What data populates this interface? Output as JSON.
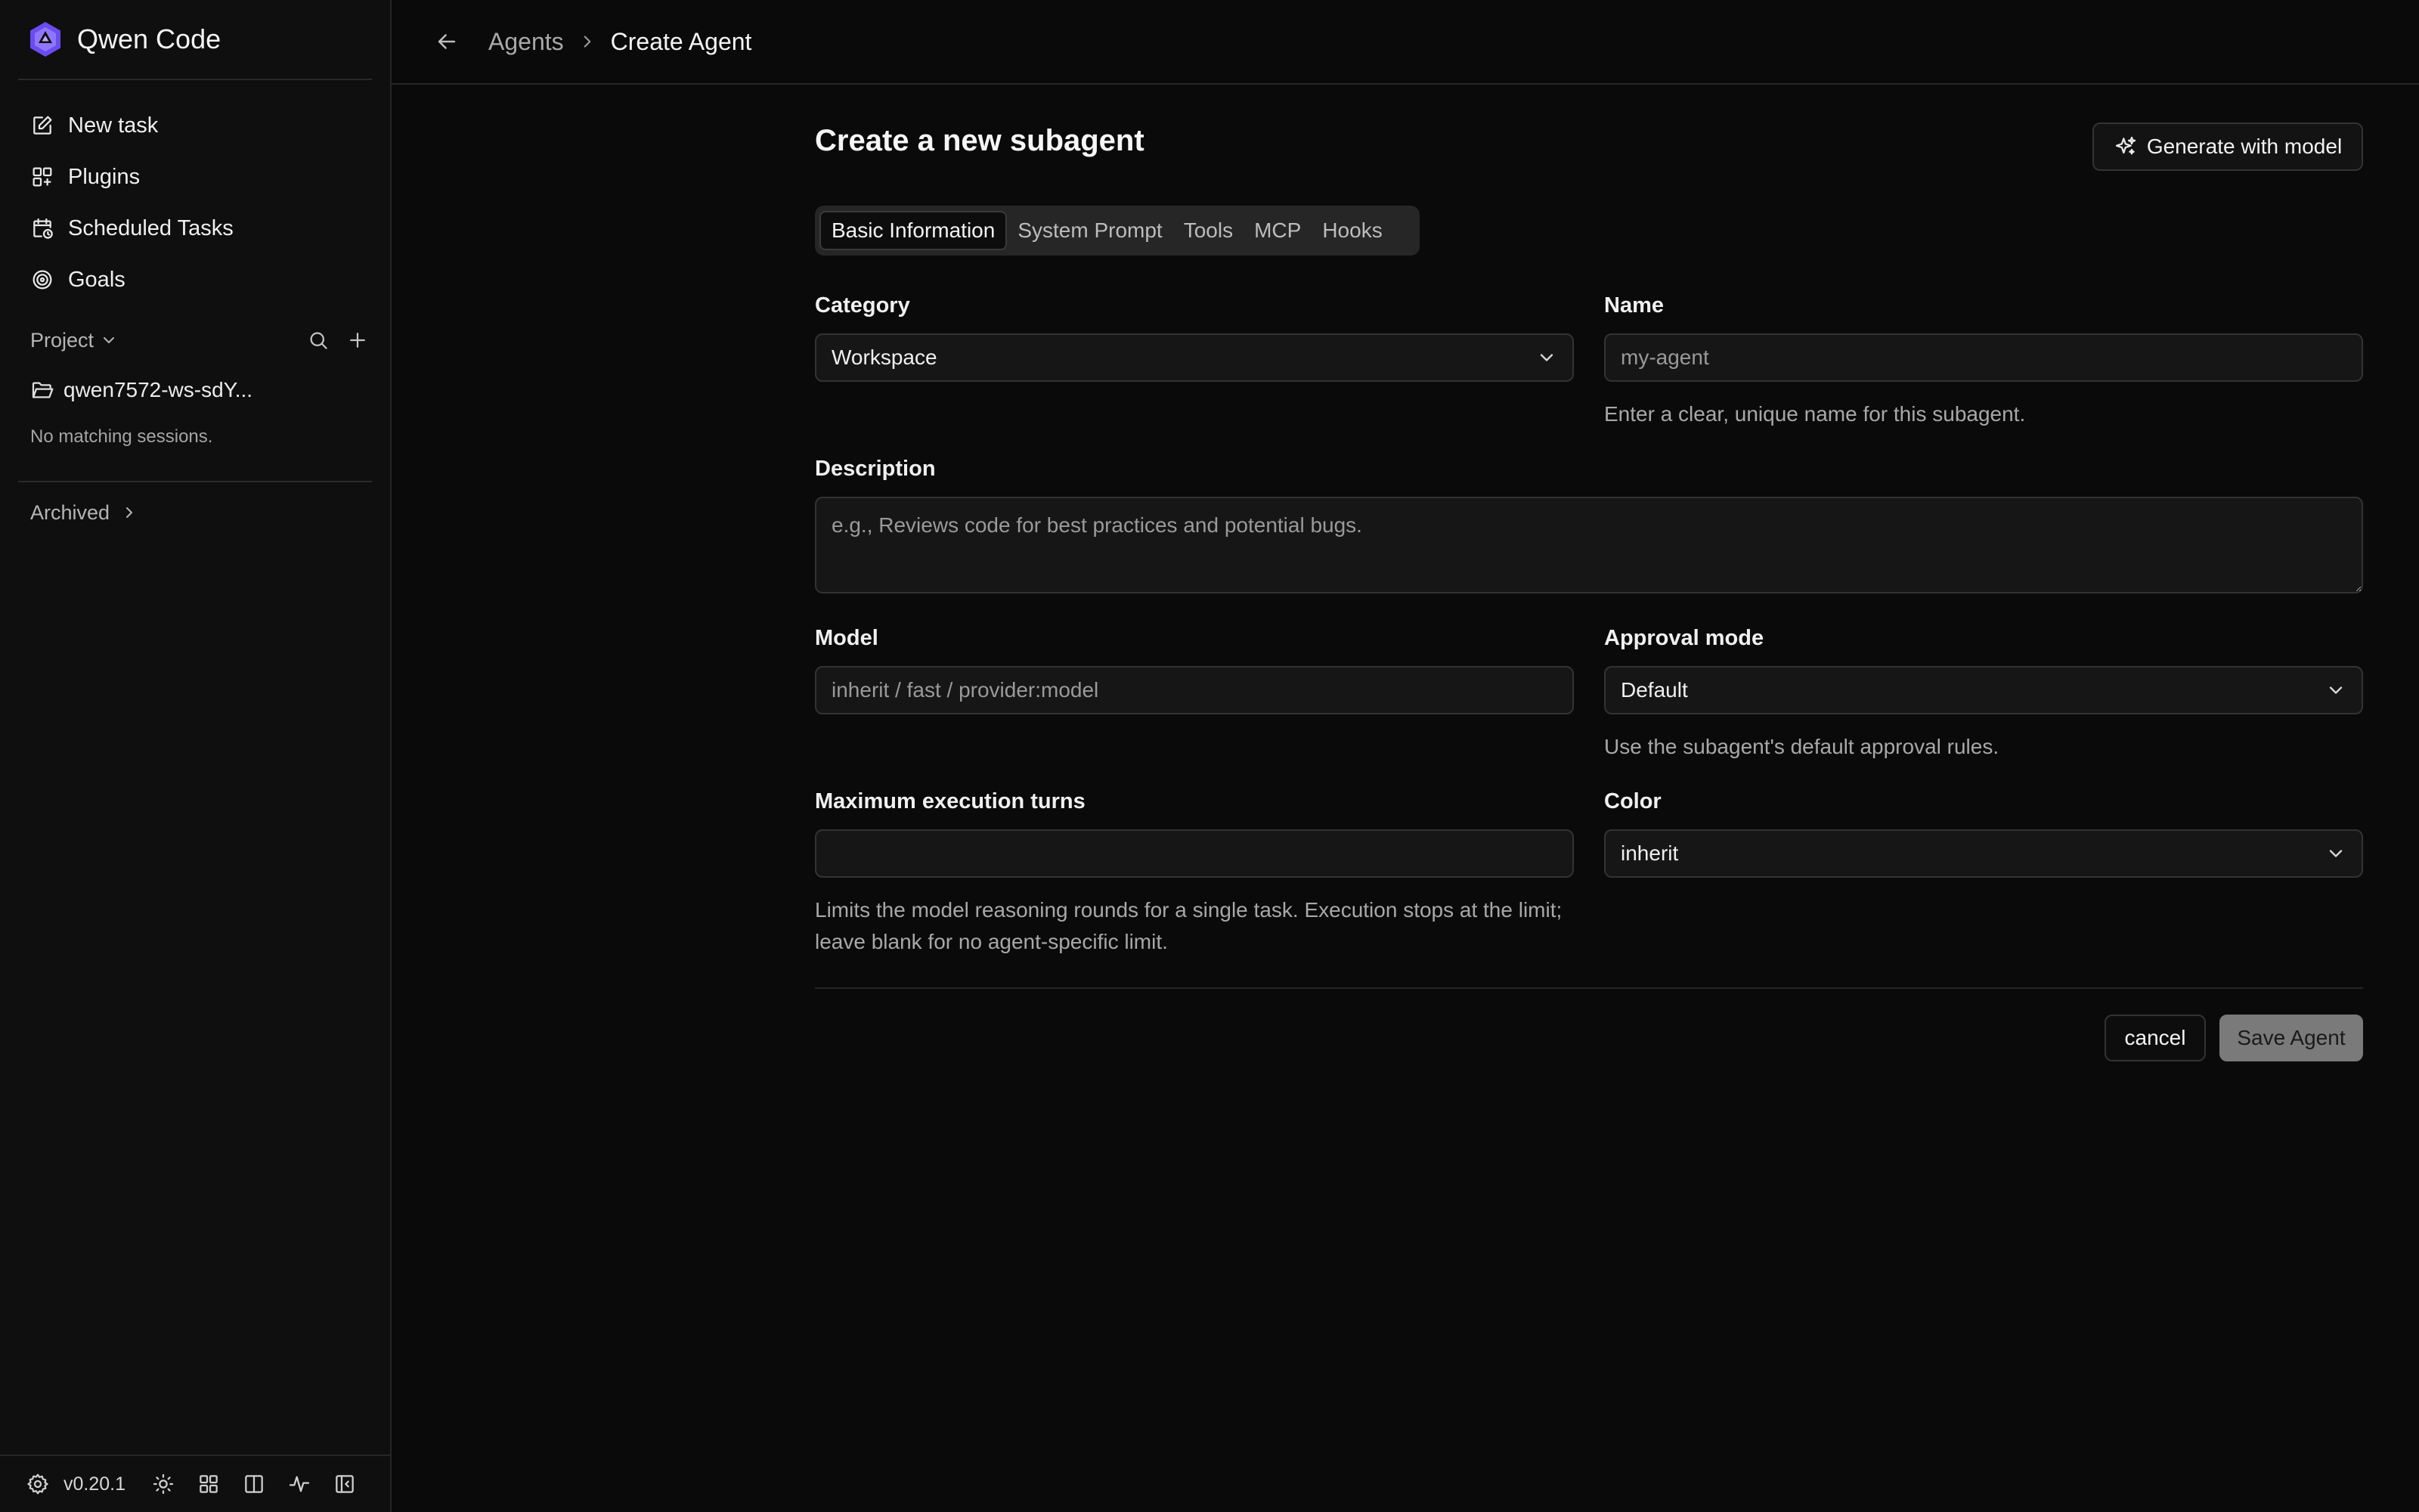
{
  "sidebar": {
    "app_title": "Qwen Code",
    "nav": [
      {
        "label": "New task",
        "icon": "edit-icon"
      },
      {
        "label": "Plugins",
        "icon": "plugins-icon"
      },
      {
        "label": "Scheduled Tasks",
        "icon": "calendar-clock-icon"
      },
      {
        "label": "Goals",
        "icon": "target-icon"
      }
    ],
    "project_label": "Project",
    "folder": "qwen7572-ws-sdY...",
    "no_sessions": "No matching sessions.",
    "archived_label": "Archived",
    "version": "v0.20.1"
  },
  "breadcrumb": {
    "parent": "Agents",
    "current": "Create Agent"
  },
  "page": {
    "title": "Create a new subagent",
    "generate_button": "Generate with model"
  },
  "tabs": [
    {
      "label": "Basic Information",
      "active": true
    },
    {
      "label": "System Prompt",
      "active": false
    },
    {
      "label": "Tools",
      "active": false
    },
    {
      "label": "MCP",
      "active": false
    },
    {
      "label": "Hooks",
      "active": false
    }
  ],
  "form": {
    "category": {
      "label": "Category",
      "value": "Workspace"
    },
    "name": {
      "label": "Name",
      "value": "",
      "placeholder": "my-agent",
      "hint": "Enter a clear, unique name for this subagent."
    },
    "description": {
      "label": "Description",
      "value": "",
      "placeholder": "e.g., Reviews code for best practices and potential bugs."
    },
    "model": {
      "label": "Model",
      "value": "",
      "placeholder": "inherit / fast / provider:model"
    },
    "approval": {
      "label": "Approval mode",
      "value": "Default",
      "hint": "Use the subagent's default approval rules."
    },
    "max_turns": {
      "label": "Maximum execution turns",
      "value": "",
      "placeholder": "",
      "hint": "Limits the model reasoning rounds for a single task. Execution stops at the limit; leave blank for no agent-specific limit."
    },
    "color": {
      "label": "Color",
      "value": "inherit"
    }
  },
  "actions": {
    "cancel": "cancel",
    "save": "Save Agent"
  },
  "colors": {
    "accent": "#7c5cf6",
    "background": "#0a0a0a",
    "sidebar": "#0f0f0f",
    "save_disabled": "#7a7a7a"
  }
}
